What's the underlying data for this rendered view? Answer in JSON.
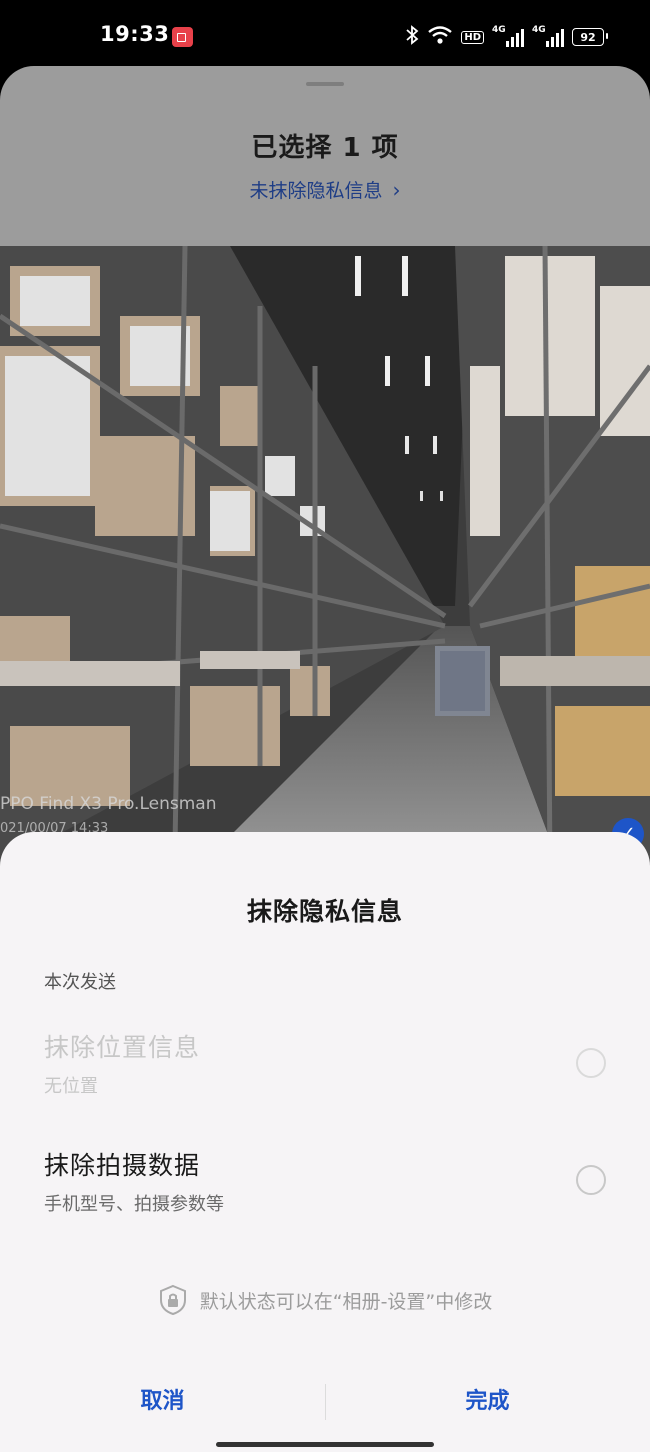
{
  "status_bar": {
    "time": "19:33",
    "hd_label": "HD",
    "net1": "4G",
    "net2": "4G",
    "battery": "92"
  },
  "header": {
    "title": "已选择 1 项",
    "privacy_link": "未抹除隐私信息"
  },
  "photo": {
    "watermark_line1": "PPO Find X3 Pro.Lensman",
    "watermark_line2": "021/00/07 14:33",
    "selected_icon": "check-icon"
  },
  "modal": {
    "title": "抹除隐私信息",
    "section_label": "本次发送",
    "options": [
      {
        "title": "抹除位置信息",
        "subtitle": "无位置",
        "enabled": false,
        "checked": false
      },
      {
        "title": "抹除拍摄数据",
        "subtitle": "手机型号、拍摄参数等",
        "enabled": true,
        "checked": false
      }
    ],
    "hint": "默认状态可以在“相册-设置”中修改",
    "cancel_label": "取消",
    "done_label": "完成"
  },
  "colors": {
    "accent": "#1e55c8",
    "link": "#1e3d86",
    "sheet_bg": "#f6f4f6"
  }
}
